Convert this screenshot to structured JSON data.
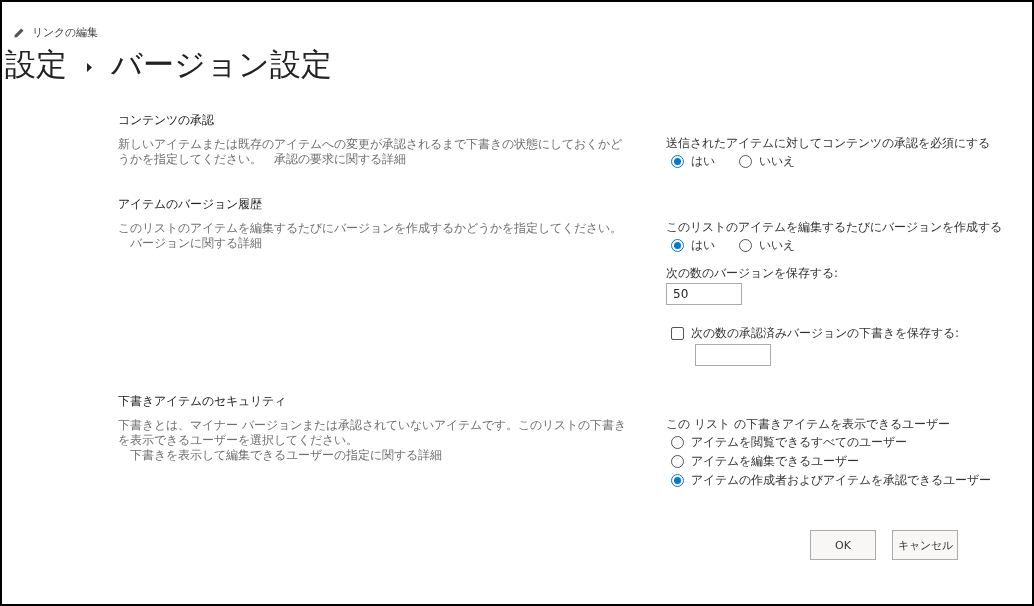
{
  "edit_link": {
    "label": "リンクの編集"
  },
  "breadcrumb": [
    {
      "label": "設定"
    },
    {
      "label": "バージョン設定"
    }
  ],
  "sections": [
    {
      "title": "コンテンツの承認",
      "description": "新しいアイテムまたは既存のアイテムへの変更が承認されるまで下書きの状態にしておくかどうかを指定してください。",
      "link": "承認の要求に関する詳細",
      "controls": [
        {
          "kind": "radio_row",
          "label": "送信されたアイテムに対してコンテンツの承認を必須にする",
          "options": [
            {
              "label": "はい",
              "selected": true
            },
            {
              "label": "いいえ",
              "selected": false
            }
          ]
        }
      ]
    },
    {
      "title": "アイテムのバージョン履歴",
      "description": "このリストのアイテムを編集するたびにバージョンを作成するかどうかを指定してください。",
      "link": "バージョンに関する詳細",
      "controls": [
        {
          "kind": "radio_row",
          "label": "このリストのアイテムを編集するたびにバージョンを作成する",
          "options": [
            {
              "label": "はい",
              "selected": true
            },
            {
              "label": "いいえ",
              "selected": false
            }
          ]
        },
        {
          "kind": "number_field",
          "label": "次の数のバージョンを保存する:",
          "value": "50"
        },
        {
          "kind": "checkbox_field",
          "label": "次の数の承認済みバージョンの下書きを保存する:",
          "checked": false
        }
      ]
    },
    {
      "title": "下書きアイテムのセキュリティ",
      "description": "下書きとは、マイナー バージョンまたは承認されていないアイテムです。このリストの下書きを表示できるユーザーを選択してください。",
      "link": "下書きを表示して編集できるユーザーの指定に関する詳細",
      "controls": [
        {
          "kind": "radio_list",
          "label": "この リスト の下書きアイテムを表示できるユーザー",
          "options": [
            {
              "label": "アイテムを閲覧できるすべてのユーザー",
              "selected": false
            },
            {
              "label": "アイテムを編集できるユーザー",
              "selected": false
            },
            {
              "label": "アイテムの作成者およびアイテムを承認できるユーザー",
              "selected": true
            }
          ]
        }
      ]
    }
  ],
  "buttons": [
    {
      "label": "OK"
    },
    {
      "label": "キャンセル"
    }
  ]
}
